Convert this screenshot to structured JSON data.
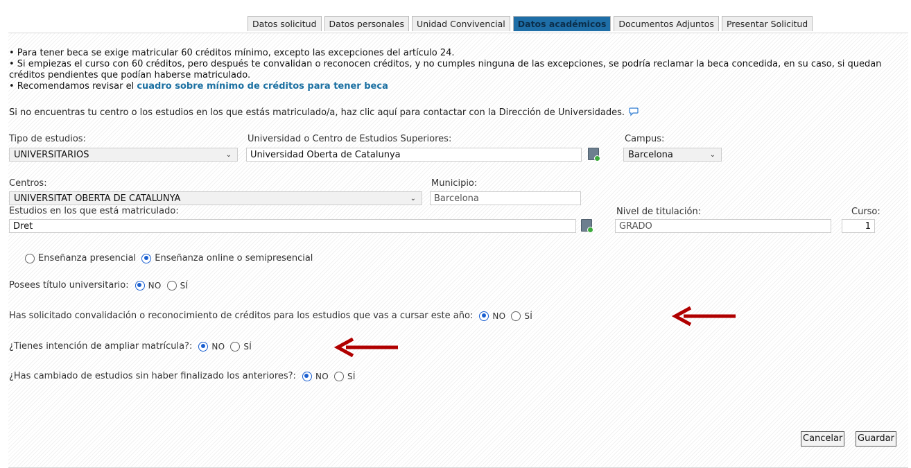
{
  "tabs": [
    "Datos solicitud",
    "Datos personales",
    "Unidad Convivencial",
    "Datos académicos",
    "Documentos Adjuntos",
    "Presentar Solicitud"
  ],
  "active_tab": "Datos académicos",
  "info": {
    "line1": "• Para tener beca se exige matricular 60 créditos mínimo, excepto las excepciones del artículo 24.",
    "line2": "• Si empiezas el curso con 60 créditos, pero después te convalidan o reconocen créditos, y no cumples ninguna de las excepciones, se podría reclamar la beca concedida, en su caso, si quedan créditos pendientes que podían haberse matriculado.",
    "line3_prefix": "• Recomendamos revisar el ",
    "line3_link": "cuadro sobre mínimo de créditos para tener beca"
  },
  "contact_text": "Si no encuentras tu centro o los estudios en los que estás matriculado/a, haz clic aquí para contactar con la Dirección de Universidades.",
  "form": {
    "tipo_label": "Tipo de estudios:",
    "tipo_value": "UNIVERSITARIOS",
    "universidad_label": "Universidad o Centro de Estudios Superiores:",
    "universidad_value": "Universidad Oberta de Catalunya",
    "campus_label": "Campus:",
    "campus_value": "Barcelona",
    "centros_label": "Centros:",
    "centros_value": "UNIVERSITAT OBERTA DE CATALUNYA",
    "municipio_label": "Municipio:",
    "municipio_value": "Barcelona",
    "estudios_label": "Estudios en los que está matriculado:",
    "estudios_value": "Dret",
    "nivel_label": "Nivel de titulación:",
    "nivel_value": "GRADO",
    "curso_label": "Curso:",
    "curso_value": "1"
  },
  "modalidad": {
    "presencial": "Enseñanza presencial",
    "online": "Enseñanza online o semipresencial",
    "selected": "online"
  },
  "questions": [
    {
      "text": "Posees título universitario:",
      "selected": "NO"
    },
    {
      "text": "Has solicitado convalidación o reconocimiento de créditos para los estudios que vas a cursar este año:",
      "selected": "NO"
    },
    {
      "text": "¿Tienes intención de ampliar matrícula?:",
      "selected": "NO"
    },
    {
      "text": "¿Has cambiado de estudios sin haber finalizado los anteriores?:",
      "selected": "NO"
    }
  ],
  "option_no": "NO",
  "option_si": "SÍ",
  "buttons": {
    "cancel": "Cancelar",
    "save": "Guardar"
  },
  "colors": {
    "active_tab": "#1e6ea7",
    "link": "#1a6fa1",
    "arrow": "#b00000",
    "radio": "#1a5fd0"
  }
}
